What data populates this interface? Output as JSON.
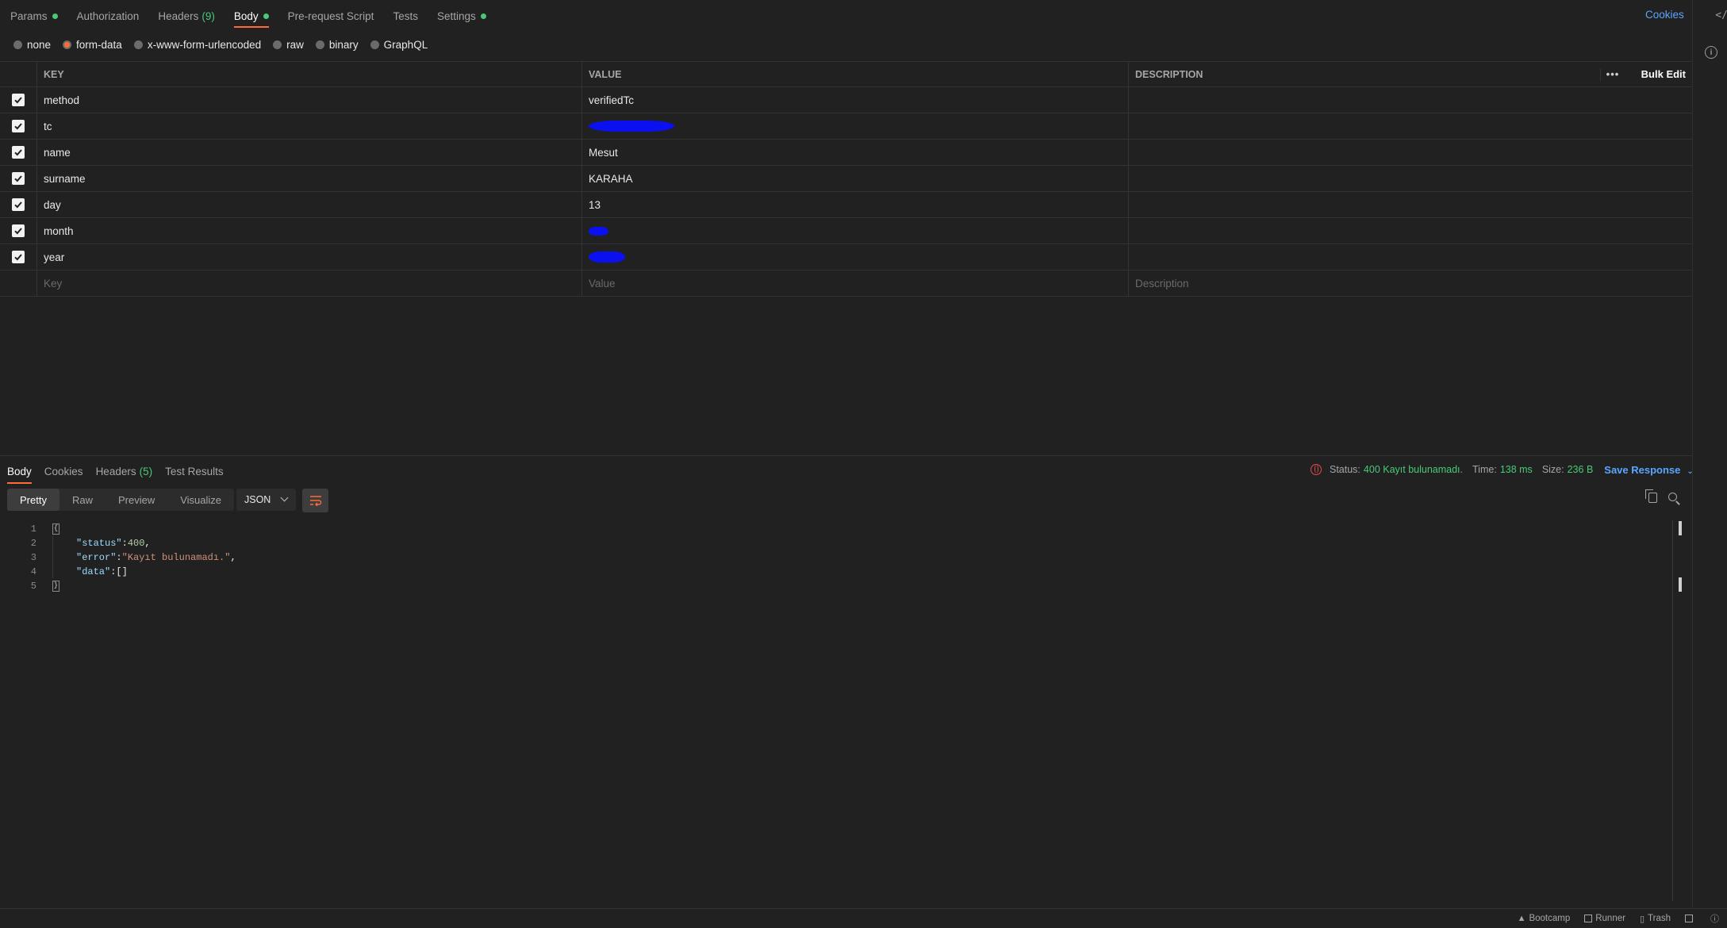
{
  "request_tabs": [
    {
      "label": "Params",
      "dot": true
    },
    {
      "label": "Authorization"
    },
    {
      "label": "Headers",
      "count": "(9)"
    },
    {
      "label": "Body",
      "dot": true,
      "active": true
    },
    {
      "label": "Pre-request Script"
    },
    {
      "label": "Tests"
    },
    {
      "label": "Settings",
      "dot": true
    }
  ],
  "cookies_link": "Cookies",
  "body_types": [
    {
      "label": "none",
      "selected": false
    },
    {
      "label": "form-data",
      "selected": true
    },
    {
      "label": "x-www-form-urlencoded",
      "selected": false
    },
    {
      "label": "raw",
      "selected": false
    },
    {
      "label": "binary",
      "selected": false
    },
    {
      "label": "GraphQL",
      "selected": false
    }
  ],
  "table": {
    "headers": {
      "key": "KEY",
      "value": "VALUE",
      "description": "DESCRIPTION"
    },
    "bulk_edit": "Bulk Edit",
    "more": "•••",
    "rows": [
      {
        "key": "method",
        "value": "verifiedTc",
        "checked": true
      },
      {
        "key": "tc",
        "value": "",
        "redacted": true,
        "checked": true
      },
      {
        "key": "name",
        "value": "Mesut",
        "checked": true
      },
      {
        "key": "surname",
        "value": "KARAHA",
        "checked": true
      },
      {
        "key": "day",
        "value": "13",
        "checked": true
      },
      {
        "key": "month",
        "value": "",
        "redacted": true,
        "checked": true
      },
      {
        "key": "year",
        "value": "",
        "redacted": true,
        "checked": true
      }
    ],
    "placeholders": {
      "key": "Key",
      "value": "Value",
      "description": "Description"
    }
  },
  "response": {
    "tabs": [
      {
        "label": "Body",
        "active": true
      },
      {
        "label": "Cookies"
      },
      {
        "label": "Headers",
        "count": "(5)"
      },
      {
        "label": "Test Results"
      }
    ],
    "status_label": "Status:",
    "status_value": "400 Kayıt bulunamadı.",
    "time_label": "Time:",
    "time_value": "138 ms",
    "size_label": "Size:",
    "size_value": "236 B",
    "save_response": "Save Response",
    "format_buttons": [
      "Pretty",
      "Raw",
      "Preview",
      "Visualize"
    ],
    "active_format": "Pretty",
    "language": "JSON",
    "line_numbers": [
      "1",
      "2",
      "3",
      "4",
      "5"
    ],
    "json": {
      "status_key": "\"status\"",
      "status_val": "400",
      "error_key": "\"error\"",
      "error_val": "\"Kayıt bulunamadı.\"",
      "data_key": "\"data\"",
      "data_val": "[]"
    }
  },
  "footer": {
    "bootcamp": "Bootcamp",
    "runner": "Runner",
    "trash": "Trash"
  },
  "colors": {
    "accent": "#ff6c37",
    "green": "#49c977",
    "link": "#5aa6ff",
    "background": "#212121"
  }
}
